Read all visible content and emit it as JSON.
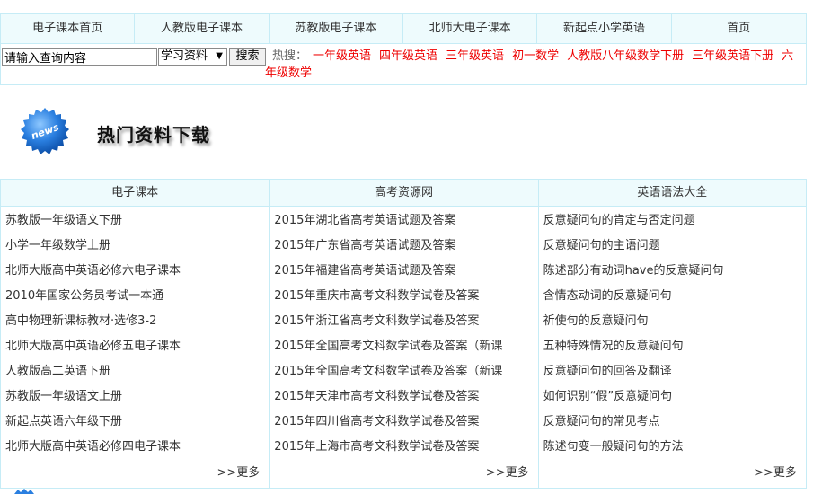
{
  "nav": [
    {
      "label": "电子课本首页"
    },
    {
      "label": "人教版电子课本"
    },
    {
      "label": "苏教版电子课本"
    },
    {
      "label": "北师大电子课本"
    },
    {
      "label": "新起点小学英语"
    },
    {
      "label": "首页"
    }
  ],
  "search": {
    "input_value": "请输入查询内容",
    "select_value": "学习资料",
    "button_label": "搜索",
    "hot_label": "热搜：",
    "hot_links": [
      "一年级英语",
      "四年级英语",
      "三年级英语",
      "初一数学",
      "人教版八年级数学下册",
      "三年级英语下册",
      "六年级数学"
    ]
  },
  "section": {
    "badge_text": "news",
    "title": "热门资料下载"
  },
  "columns": [
    {
      "title": "电子课本",
      "items": [
        "苏教版一年级语文下册",
        "小学一年级数学上册",
        "北师大版高中英语必修六电子课本",
        "2010年国家公务员考试一本通",
        "高中物理新课标教材·选修3-2",
        "北师大版高中英语必修五电子课本",
        "人教版高二英语下册",
        "苏教版一年级语文上册",
        "新起点英语六年级下册",
        "北师大版高中英语必修四电子课本"
      ],
      "more": ">>更多"
    },
    {
      "title": "高考资源网",
      "items": [
        "2015年湖北省高考英语试题及答案",
        "2015年广东省高考英语试题及答案",
        "2015年福建省高考英语试题及答案",
        "2015年重庆市高考文科数学试卷及答案",
        "2015年浙江省高考文科数学试卷及答案",
        "2015年全国高考文科数学试卷及答案（新课",
        "2015年全国高考文科数学试卷及答案（新课",
        "2015年天津市高考文科数学试卷及答案",
        "2015年四川省高考文科数学试卷及答案",
        "2015年上海市高考文科数学试卷及答案"
      ],
      "more": ">>更多"
    },
    {
      "title": "英语语法大全",
      "items": [
        "反意疑问句的肯定与否定问题",
        "反意疑问句的主语问题",
        "陈述部分有动词have的反意疑问句",
        "含情态动词的反意疑问句",
        "祈使句的反意疑问句",
        "五种特殊情况的反意疑问句",
        "反意疑问句的回答及翻译",
        "如何识别“假”反意疑问句",
        "反意疑问句的常见考点",
        "陈述句变一般疑问句的方法"
      ],
      "more": ">>更多"
    }
  ]
}
